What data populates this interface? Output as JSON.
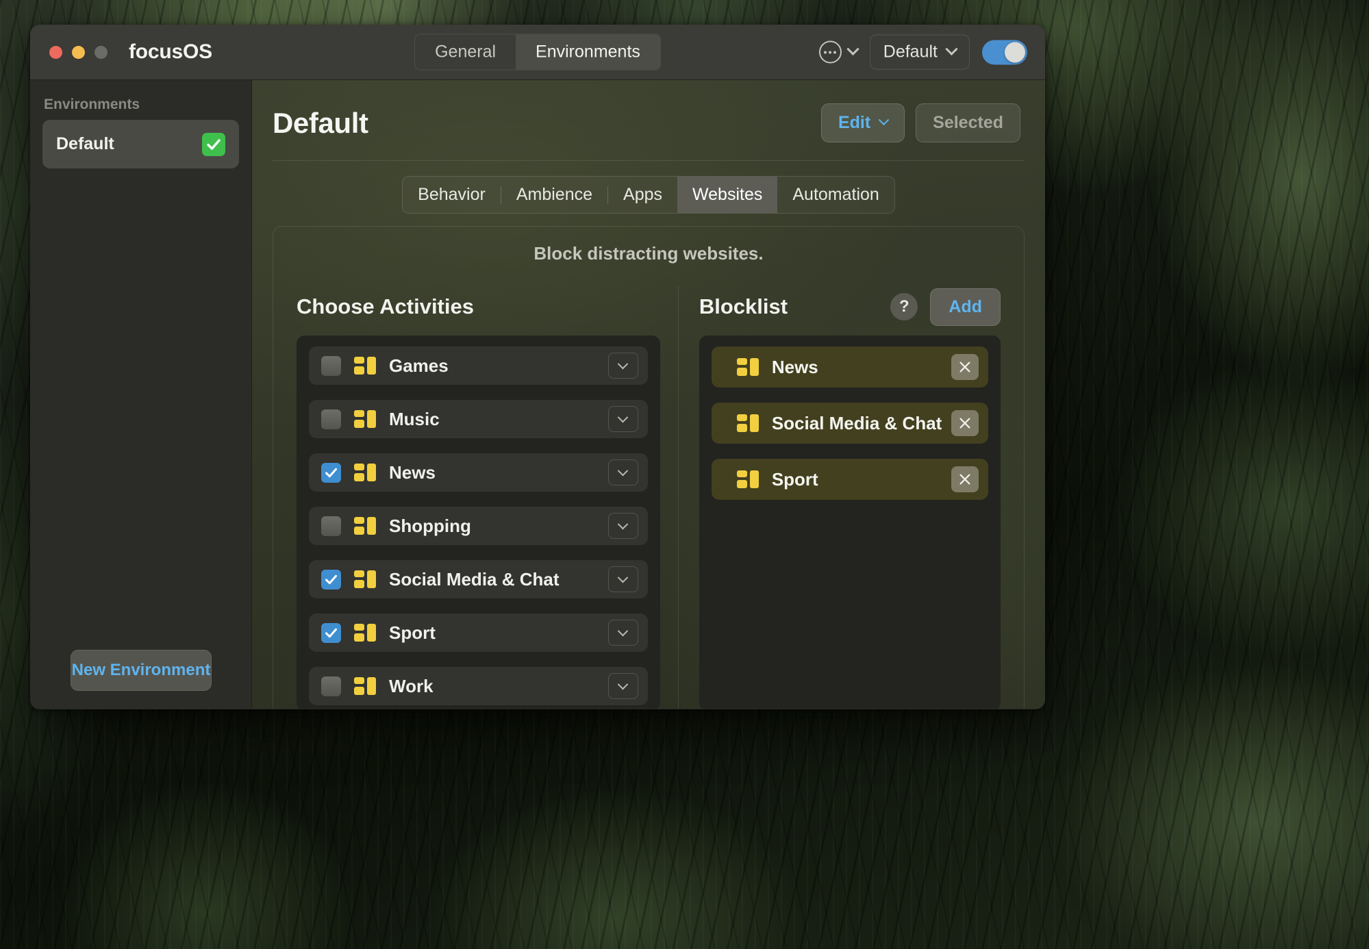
{
  "window": {
    "app_title": "focusOS",
    "traffic_lights": [
      "close-red",
      "minimize-yellow",
      "zoom-gray"
    ]
  },
  "titlebar": {
    "segments": [
      {
        "label": "General",
        "active": false
      },
      {
        "label": "Environments",
        "active": true
      }
    ],
    "more_menu_icon": "circle-ellipsis-icon",
    "more_menu_chevron": "chevron-down-icon",
    "profile_dropdown": "Default",
    "master_toggle": {
      "state": "on",
      "color": "#4a90d0"
    }
  },
  "sidebar": {
    "header": "Environments",
    "items": [
      {
        "label": "Default",
        "selected": true,
        "badge": "green-check"
      }
    ],
    "new_environment_button": "New Environment"
  },
  "main": {
    "page_title": "Default",
    "edit_button": "Edit",
    "selected_button": "Selected",
    "tabs": [
      {
        "label": "Behavior",
        "active": false
      },
      {
        "label": "Ambience",
        "active": false
      },
      {
        "label": "Apps",
        "active": false
      },
      {
        "label": "Websites",
        "active": true
      },
      {
        "label": "Automation",
        "active": false
      }
    ],
    "panel_subtitle": "Block distracting websites."
  },
  "activities": {
    "title": "Choose Activities",
    "rows": [
      {
        "label": "Games",
        "checked": false
      },
      {
        "label": "Music",
        "checked": false
      },
      {
        "label": "News",
        "checked": true
      },
      {
        "label": "Shopping",
        "checked": false
      },
      {
        "label": "Social Media & Chat",
        "checked": true
      },
      {
        "label": "Sport",
        "checked": true
      },
      {
        "label": "Work",
        "checked": false
      }
    ]
  },
  "blocklist": {
    "title": "Blocklist",
    "help_label": "?",
    "add_button": "Add",
    "rows": [
      {
        "label": "News"
      },
      {
        "label": "Social Media & Chat"
      },
      {
        "label": "Sport"
      }
    ]
  },
  "colors": {
    "accent_blue": "#5fb4ef",
    "toggle_blue": "#4a90d0",
    "checkbox_blue": "#3f8ed0",
    "activity_icon_yellow": "#f2cf3f",
    "blocklist_row_bg": "#43401f",
    "green_check": "#3fc04c"
  }
}
